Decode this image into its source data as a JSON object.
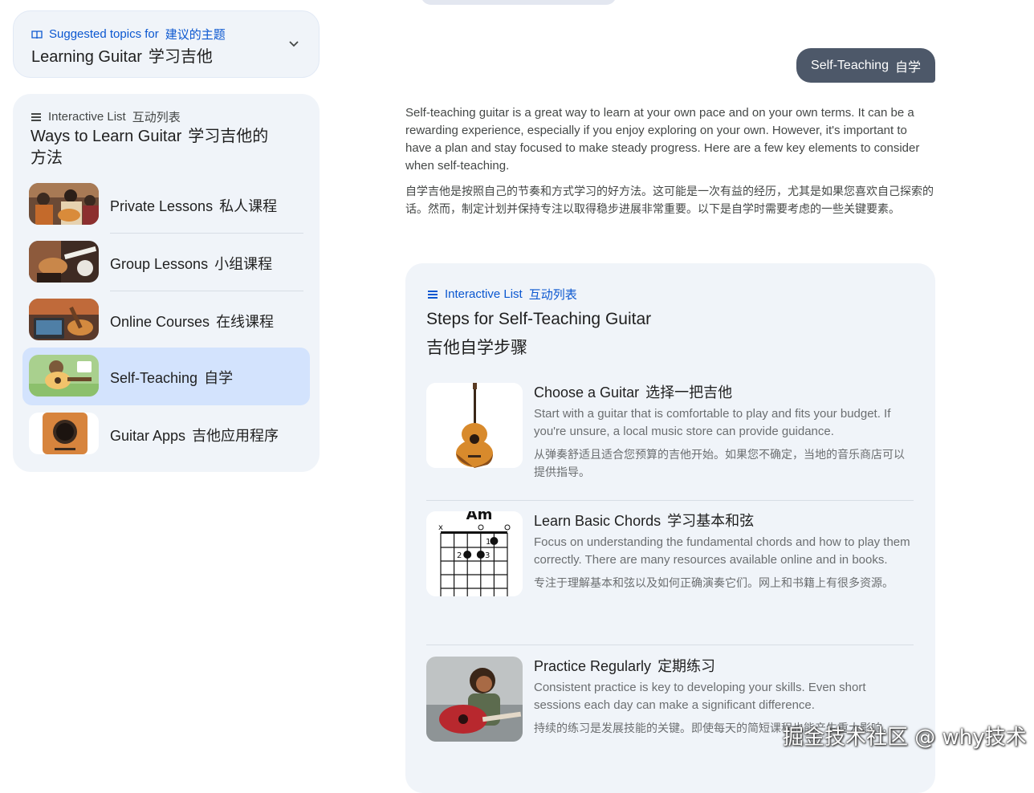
{
  "topic": {
    "label_en": "Suggested topics for",
    "label_cn": "建议的主题",
    "title_en": "Learning Guitar",
    "title_cn": "学习吉他"
  },
  "left_list": {
    "label_en": "Interactive List",
    "label_cn": "互动列表",
    "title_en": "Ways to Learn Guitar",
    "title_cn": "学习吉他的方法",
    "items": [
      {
        "en": "Private Lessons",
        "cn": "私人课程"
      },
      {
        "en": "Group Lessons",
        "cn": "小组课程"
      },
      {
        "en": "Online Courses",
        "cn": "在线课程"
      },
      {
        "en": "Self-Teaching",
        "cn": "自学"
      },
      {
        "en": "Guitar Apps",
        "cn": "吉他应用程序"
      }
    ],
    "selected_index": 3
  },
  "chip": {
    "en": "Self-Teaching",
    "cn": "自学"
  },
  "intro": {
    "en": "Self-teaching guitar is a great way to learn at your own pace and on your own terms. It can be a rewarding experience, especially if you enjoy exploring on your own. However, it's important to have a plan and stay focused to make steady progress. Here are a few key elements to consider when self-teaching.",
    "cn": "自学吉他是按照自己的节奏和方式学习的好方法。这可能是一次有益的经历，尤其是如果您喜欢自己探索的话。然而，制定计划并保持专注以取得稳步进展非常重要。以下是自学时需要考虑的一些关键要素。"
  },
  "steps": {
    "label_en": "Interactive List",
    "label_cn": "互动列表",
    "title_en": "Steps for Self-Teaching Guitar",
    "title_cn": "吉他自学步骤",
    "chord_name": "Am",
    "items": [
      {
        "title_en": "Choose a Guitar",
        "title_cn": "选择一把吉他",
        "desc_en": "Start with a guitar that is comfortable to play and fits your budget. If you're unsure, a local music store can provide guidance.",
        "desc_cn": "从弹奏舒适且适合您预算的吉他开始。如果您不确定，当地的音乐商店可以提供指导。"
      },
      {
        "title_en": "Learn Basic Chords",
        "title_cn": "学习基本和弦",
        "desc_en": "Focus on understanding the fundamental chords and how to play them correctly. There are many resources available online and in books.",
        "desc_cn": "专注于理解基本和弦以及如何正确演奏它们。网上和书籍上有很多资源。"
      },
      {
        "title_en": "Practice Regularly",
        "title_cn": "定期练习",
        "desc_en": "Consistent practice is key to developing your skills. Even short sessions each day can make a significant difference.",
        "desc_cn": "持续的练习是发展技能的关键。即使每天的简短课程也能产生重大影响。"
      }
    ]
  },
  "watermark": "掘金技术社区 @ why技术",
  "colors": {
    "accent": "#0b57d0",
    "card_bg": "#f0f4f9",
    "selected_bg": "#d3e3fd",
    "chip_bg": "#4d5869"
  }
}
